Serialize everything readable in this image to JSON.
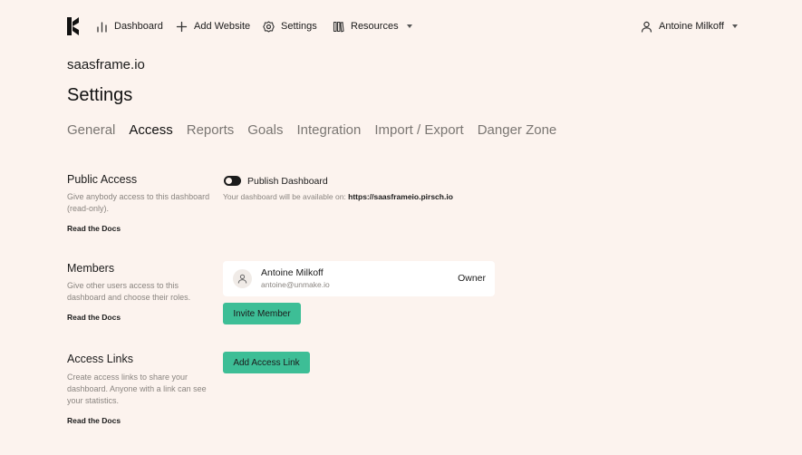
{
  "nav": {
    "dashboard": "Dashboard",
    "add_website": "Add Website",
    "settings": "Settings",
    "resources": "Resources",
    "user": "Antoine Milkoff"
  },
  "site_name": "saasframe.io",
  "page_title": "Settings",
  "tabs": [
    {
      "label": "General",
      "active": false
    },
    {
      "label": "Access",
      "active": true
    },
    {
      "label": "Reports",
      "active": false
    },
    {
      "label": "Goals",
      "active": false
    },
    {
      "label": "Integration",
      "active": false
    },
    {
      "label": "Import / Export",
      "active": false
    },
    {
      "label": "Danger Zone",
      "active": false
    }
  ],
  "public_access": {
    "title": "Public Access",
    "desc": "Give anybody access to this dashboard (read-only).",
    "docs": "Read the Docs",
    "toggle_label": "Publish Dashboard",
    "available_prefix": "Your dashboard will be available on:",
    "available_url": "https://saasframeio.pirsch.io"
  },
  "members": {
    "title": "Members",
    "desc": "Give other users access to this dashboard and choose their roles.",
    "docs": "Read the Docs",
    "member_name": "Antoine Milkoff",
    "member_email": "antoine@unmake.io",
    "member_role": "Owner",
    "invite_button": "Invite Member"
  },
  "access_links": {
    "title": "Access Links",
    "desc": "Create access links to share your dashboard. Anyone with a link can see your statistics.",
    "docs": "Read the Docs",
    "add_button": "Add Access Link"
  },
  "colors": {
    "background": "#fcf3ee",
    "accent": "#3dbe96",
    "text": "#1b1b1b",
    "muted": "#8a8580"
  }
}
